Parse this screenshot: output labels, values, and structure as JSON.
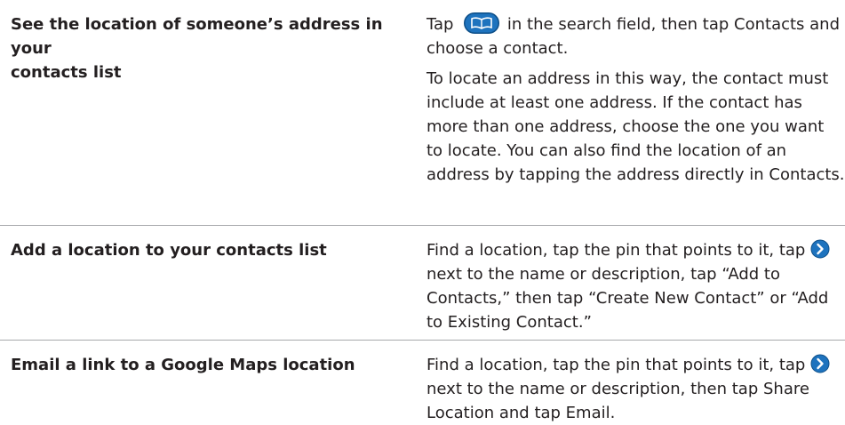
{
  "rows": [
    {
      "task": "See the location of someone’s address in your\ncontacts list",
      "steps": [
        {
          "before_icon": "Tap",
          "icon": "bookmarks-icon",
          "after_icon": "in the search field, then tap Contacts and choose a contact."
        },
        {
          "text": "To locate an address in this way, the contact must include at least one address. If the contact has more than one address, choose the one you want to locate. You can also find the location of an address by tapping the address directly in Contacts."
        }
      ]
    },
    {
      "task": "Add a location to your contacts list",
      "steps": [
        {
          "before_icon": "Find a location, tap the pin that points to it, tap",
          "icon": "detail-disclosure-icon",
          "after_icon": "next to the name or description, tap “Add to Contacts,” then tap “Create New Contact” or “Add to Existing Contact.”"
        }
      ]
    },
    {
      "task": "Email a link to a Google Maps location",
      "steps": [
        {
          "before_icon": "Find a location, tap the pin that points to it, tap",
          "icon": "detail-disclosure-icon",
          "after_icon": "next to the name or description, then tap Share Location and tap Email."
        }
      ]
    }
  ],
  "colors": {
    "text": "#231f20",
    "rule": "#a7a9ac",
    "icon_blue": "#1e73be"
  }
}
